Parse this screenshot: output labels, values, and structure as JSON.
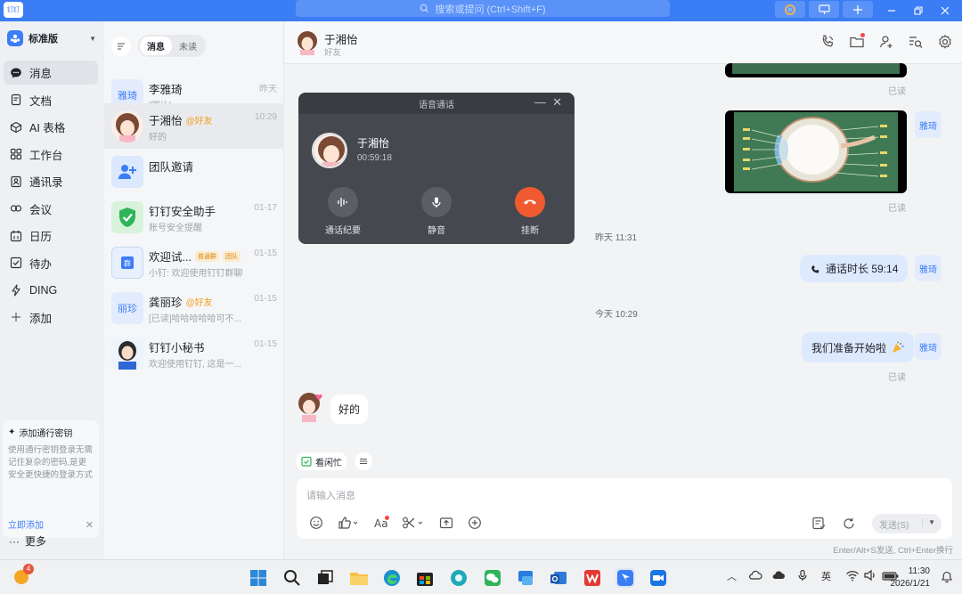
{
  "titlebar": {
    "app_logo": "钉钉",
    "search_placeholder": "搜索或提问 (Ctrl+Shift+F)"
  },
  "leftnav": {
    "org_name": "标准版",
    "items": [
      {
        "label": "消息",
        "icon": "chat-bubble-icon",
        "active": true
      },
      {
        "label": "文档",
        "icon": "document-icon"
      },
      {
        "label": "AI 表格",
        "icon": "ai-table-icon"
      },
      {
        "label": "工作台",
        "icon": "grid-icon"
      },
      {
        "label": "通讯录",
        "icon": "contacts-icon"
      },
      {
        "label": "会议",
        "icon": "meeting-icon"
      },
      {
        "label": "日历",
        "icon": "calendar-icon"
      },
      {
        "label": "待办",
        "icon": "todo-check-icon"
      },
      {
        "label": "DING",
        "icon": "lightning-icon"
      },
      {
        "label": "添加",
        "icon": "plus-icon"
      }
    ],
    "passkey": {
      "title": "添加通行密钥",
      "desc": "使用通行密钥登录无需记住复杂的密码,是更安全更快捷的登录方式",
      "link": "立即添加"
    },
    "more": "更多"
  },
  "convlist": {
    "tabs": [
      "消息",
      "未读"
    ],
    "conversations": [
      {
        "name": "李雅琦",
        "avatar_text": "雅琦",
        "preview": "[图片]",
        "time": "昨天"
      },
      {
        "name": "于湘怡",
        "tag": "@好友",
        "preview": "好的",
        "time": "10:29",
        "active": true
      },
      {
        "name": "团队邀请",
        "preview": "",
        "time": ""
      },
      {
        "name": "钉钉安全助手",
        "preview": "账号安全提醒",
        "time": "01-17"
      },
      {
        "name": "欢迎试...",
        "chips": [
          "普通群",
          "团队"
        ],
        "preview": "小钉: 欢迎使用钉钉群聊",
        "time": "01-15"
      },
      {
        "name": "龚丽珍",
        "avatar_text": "丽珍",
        "tag": "@好友",
        "preview": "[已读]哈哈哈哈哈可不...",
        "time": "01-15"
      },
      {
        "name": "钉钉小秘书",
        "preview": "欢迎使用钉钉, 这是一...",
        "time": "01-15"
      }
    ]
  },
  "chat": {
    "contact_name": "于湘怡",
    "contact_sub": "好友",
    "read_label": "已读",
    "my_avatar_text": "雅琦",
    "sep_yesterday": "昨天 11:31",
    "call_duration_msg": "通话时长 59:14",
    "sep_today": "今天 10:29",
    "msg_ready": "我们准备开始啦",
    "msg_ok": "好的",
    "quick_action": "看闲忙"
  },
  "call": {
    "title": "语音通话",
    "name": "于湘怡",
    "timer": "00:59:18",
    "buttons": {
      "record": "通话纪要",
      "mute": "静音",
      "hangup": "挂断"
    }
  },
  "composer": {
    "placeholder": "请输入消息",
    "send_label": "发送(S)",
    "hint": "Enter/Alt+S发送, Ctrl+Enter换行"
  },
  "taskbar": {
    "badge": "4",
    "ime": "英",
    "time": "11:30",
    "date": "2026/1/21"
  },
  "colors": {
    "accent": "#3b7df5",
    "hangup": "#f05a30",
    "my_bubble": "#dde9fd"
  }
}
